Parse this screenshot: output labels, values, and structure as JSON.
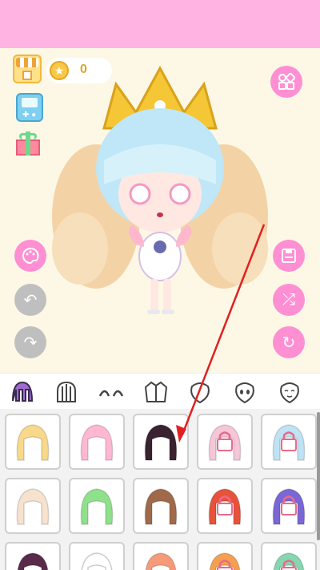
{
  "hud": {
    "coin_count": "0"
  },
  "tabs": [
    {
      "name": "hair-front"
    },
    {
      "name": "hair-back"
    },
    {
      "name": "eyebrows"
    },
    {
      "name": "outfit"
    },
    {
      "name": "face"
    },
    {
      "name": "eyes"
    },
    {
      "name": "mouth"
    }
  ],
  "hair_items": [
    {
      "color": "#f8d98c",
      "locked": false
    },
    {
      "color": "#ffb7d2",
      "locked": false
    },
    {
      "color": "#3a2230",
      "locked": false,
      "selected": true
    },
    {
      "color": "#f5c6d8",
      "locked": true
    },
    {
      "color": "#bfe3f5",
      "locked": true
    },
    {
      "color": "#f7e2cf",
      "locked": false
    },
    {
      "color": "#8fe08a",
      "locked": false
    },
    {
      "color": "#a06a4a",
      "locked": false
    },
    {
      "color": "#e8523a",
      "locked": true
    },
    {
      "color": "#7b66d6",
      "locked": true
    },
    {
      "color": "#5a2a4a",
      "locked": false
    },
    {
      "color": "#ffffff",
      "locked": false
    },
    {
      "color": "#f59b7a",
      "locked": false
    },
    {
      "color": "#f5a050",
      "locked": true
    },
    {
      "color": "#86d6b0",
      "locked": true
    }
  ],
  "colors": {
    "banner": "#ffb3e3",
    "accent_pink": "#ff8fd3",
    "disabled_gray": "#bfbfbf",
    "arrow_red": "#e02020"
  }
}
